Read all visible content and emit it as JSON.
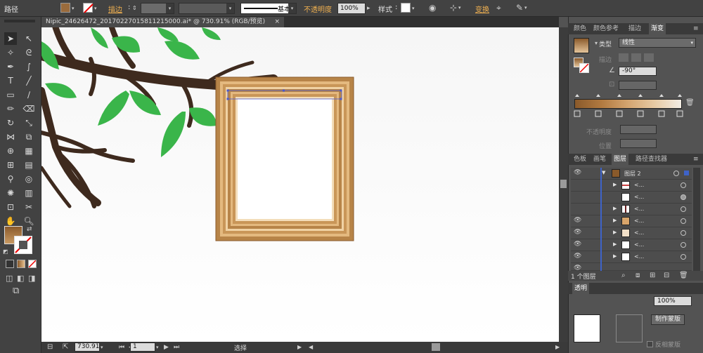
{
  "control_bar": {
    "object_type": "路径",
    "stroke_label": "描边",
    "stroke_style": "基本",
    "opacity_label": "不透明度",
    "opacity_value": "100%",
    "style_label": "样式",
    "transform_label": "变换",
    "fill_color": "#9a6b3c"
  },
  "document": {
    "tab_title": "Nipic_24626472_20170227015811215000.ai* @ 730.91% (RGB/预览)"
  },
  "gradient_panel": {
    "tabs": [
      "颜色",
      "颜色参考",
      "描边",
      "渐变"
    ],
    "active_tab": "渐变",
    "type_label": "类型",
    "type_value": "线性",
    "stroke_label": "描边",
    "angle_value": "-90°",
    "opacity_label": "不透明度",
    "position_label": "位置",
    "ramp_start": "#8a5a2b",
    "ramp_end": "#f2ece4"
  },
  "layers_panel": {
    "tabs": [
      "色板",
      "画笔",
      "图层",
      "路径查找器"
    ],
    "active_tab": "图层",
    "layer_name": "图层 2",
    "sublayer_label": "<...",
    "layer_count": "1 个图层"
  },
  "transparency_panel": {
    "title": "透明",
    "opacity_value": "100%",
    "make_mask_button": "制作蒙版",
    "release_label": "反相蒙版"
  },
  "status_bar": {
    "zoom": "730.91",
    "page": "1",
    "tool_name": "选择"
  },
  "artwork": {
    "frame_outer": "#b78448",
    "frame_light": "#e4b97f",
    "branch_color": "#3e2a1e",
    "leaf_color": "#3ab54a"
  }
}
